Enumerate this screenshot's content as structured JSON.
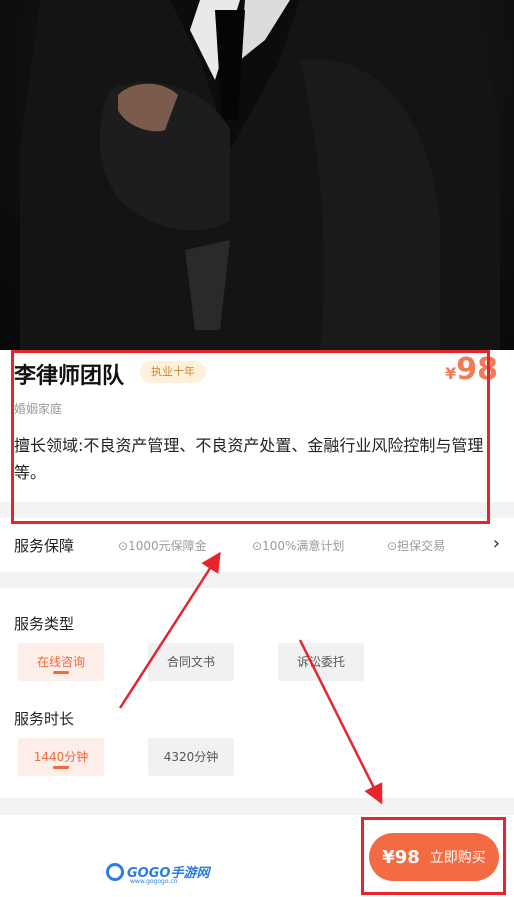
{
  "lawyer": {
    "name": "李律师团队",
    "experience_badge": "执业十年",
    "price_currency": "¥",
    "price_value": "98",
    "category": "婚姻家庭",
    "description": "擅长领域:不良资产管理、不良资产处置、金融行业风险控制与管理等。"
  },
  "guarantee": {
    "title": "服务保障",
    "items": [
      "1000元保障金",
      "100%满意计划",
      "担保交易"
    ],
    "item_icon": "check-circle-icon",
    "more_icon": "chevron-right-icon"
  },
  "service_type": {
    "title": "服务类型",
    "options": [
      "在线咨询",
      "合同文书",
      "诉讼委托"
    ],
    "selected": "在线咨询"
  },
  "service_duration": {
    "title": "服务时长",
    "options": [
      "1440分钟",
      "4320分钟"
    ],
    "selected": "1440分钟"
  },
  "footer": {
    "buy_price": "¥98",
    "buy_label": "立即购买",
    "watermark": "GOGO手游网",
    "watermark_url": "www.gogogo.cn"
  },
  "colors": {
    "accent": "#f26b43",
    "badge_bg": "#fdf1dc",
    "annotation_red": "#e8232b"
  }
}
